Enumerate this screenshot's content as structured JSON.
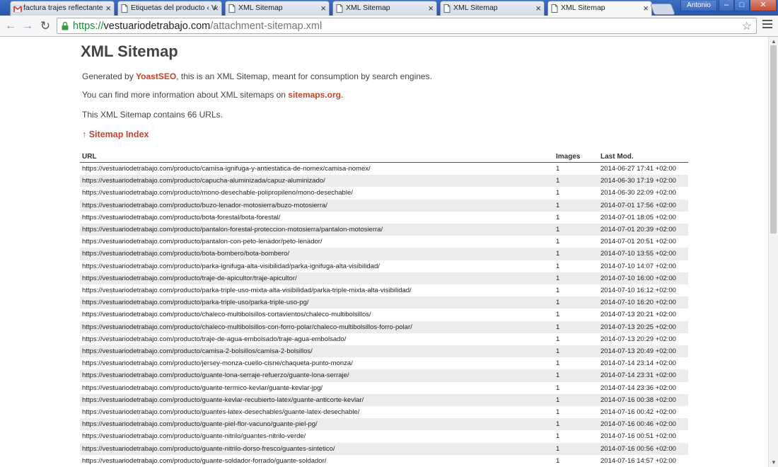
{
  "browser": {
    "tabs": [
      {
        "title": "factura trajes reflectante",
        "icon": "gmail-icon",
        "active": false
      },
      {
        "title": "Etiquetas del producto ‹ V",
        "icon": "page-icon",
        "active": false
      },
      {
        "title": "XML Sitemap",
        "icon": "page-icon",
        "active": false
      },
      {
        "title": "XML Sitemap",
        "icon": "page-icon",
        "active": false
      },
      {
        "title": "XML Sitemap",
        "icon": "page-icon",
        "active": false
      },
      {
        "title": "XML Sitemap",
        "icon": "page-icon",
        "active": true
      }
    ],
    "user_name": "Antonio",
    "url_scheme": "https://",
    "url_host": "vestuariodetrabajo.com",
    "url_path": "/attachment-sitemap.xml"
  },
  "page": {
    "title": "XML Sitemap",
    "generated_prefix": "Generated by ",
    "generator_link": "YoastSEO",
    "generated_suffix": ", this is an XML Sitemap, meant for consumption by search engines.",
    "info_prefix": "You can find more information about XML sitemaps on ",
    "info_link": "sitemaps.org",
    "info_suffix": ".",
    "count_text": "This XML Sitemap contains 66 URLs.",
    "index_link": "↑ Sitemap Index",
    "columns": [
      "URL",
      "Images",
      "Last Mod."
    ],
    "rows": [
      {
        "url": "https://vestuariodetrabajo.com/producto/camisa-ignifuga-y-antiestatica-de-nomex/camisa-nomex/",
        "images": "1",
        "lastmod": "2014-06-27 17:41 +02:00"
      },
      {
        "url": "https://vestuariodetrabajo.com/producto/capucha-aluminizada/capuz-aluminizado/",
        "images": "1",
        "lastmod": "2014-06-30 17:19 +02:00"
      },
      {
        "url": "https://vestuariodetrabajo.com/producto/mono-desechable-polipropileno/mono-desechable/",
        "images": "1",
        "lastmod": "2014-06-30 22:09 +02:00"
      },
      {
        "url": "https://vestuariodetrabajo.com/producto/buzo-lenador-motosierra/buzo-motosierra/",
        "images": "1",
        "lastmod": "2014-07-01 17:56 +02:00"
      },
      {
        "url": "https://vestuariodetrabajo.com/producto/bota-forestal/bota-forestal/",
        "images": "1",
        "lastmod": "2014-07-01 18:05 +02:00"
      },
      {
        "url": "https://vestuariodetrabajo.com/producto/pantalon-forestal-proteccion-motosierra/pantalon-motosierra/",
        "images": "1",
        "lastmod": "2014-07-01 20:39 +02:00"
      },
      {
        "url": "https://vestuariodetrabajo.com/producto/pantalon-con-peto-lenador/peto-lenador/",
        "images": "1",
        "lastmod": "2014-07-01 20:51 +02:00"
      },
      {
        "url": "https://vestuariodetrabajo.com/producto/bota-bombero/bota-bombero/",
        "images": "1",
        "lastmod": "2014-07-10 13:55 +02:00"
      },
      {
        "url": "https://vestuariodetrabajo.com/producto/parka-ignifuga-alta-visibilidad/parka-ignifuga-alta-visibilidad/",
        "images": "1",
        "lastmod": "2014-07-10 14:07 +02:00"
      },
      {
        "url": "https://vestuariodetrabajo.com/producto/traje-de-apicultor/traje-apicultor/",
        "images": "1",
        "lastmod": "2014-07-10 16:00 +02:00"
      },
      {
        "url": "https://vestuariodetrabajo.com/producto/parka-triple-uso-mixta-alta-visibilidad/parka-triple-mixta-alta-visibilidad/",
        "images": "1",
        "lastmod": "2014-07-10 16:12 +02:00"
      },
      {
        "url": "https://vestuariodetrabajo.com/producto/parka-triple-uso/parka-triple-uso-pg/",
        "images": "1",
        "lastmod": "2014-07-10 16:20 +02:00"
      },
      {
        "url": "https://vestuariodetrabajo.com/producto/chaleco-multibolsillos-cortavientos/chaleco-multibolsillos/",
        "images": "1",
        "lastmod": "2014-07-13 20:21 +02:00"
      },
      {
        "url": "https://vestuariodetrabajo.com/producto/chaleco-multibolsillos-con-forro-polar/chaleco-multibolsillos-forro-polar/",
        "images": "1",
        "lastmod": "2014-07-13 20:25 +02:00"
      },
      {
        "url": "https://vestuariodetrabajo.com/producto/traje-de-agua-embolsado/traje-agua-embolsado/",
        "images": "1",
        "lastmod": "2014-07-13 20:29 +02:00"
      },
      {
        "url": "https://vestuariodetrabajo.com/producto/camisa-2-bolsillos/camisa-2-bolsillos/",
        "images": "1",
        "lastmod": "2014-07-13 20:49 +02:00"
      },
      {
        "url": "https://vestuariodetrabajo.com/producto/jersey-monza-cuello-cisne/chaqueta-punto-monza/",
        "images": "1",
        "lastmod": "2014-07-14 23:14 +02:00"
      },
      {
        "url": "https://vestuariodetrabajo.com/producto/guante-lona-serraje-refuerzo/guante-lona-serraje/",
        "images": "1",
        "lastmod": "2014-07-14 23:31 +02:00"
      },
      {
        "url": "https://vestuariodetrabajo.com/producto/guante-termico-kevlar/guante-kevlar-jpg/",
        "images": "1",
        "lastmod": "2014-07-14 23:36 +02:00"
      },
      {
        "url": "https://vestuariodetrabajo.com/producto/guante-kevlar-recubierto-latex/guante-anticorte-kevlar/",
        "images": "1",
        "lastmod": "2014-07-16 00:38 +02:00"
      },
      {
        "url": "https://vestuariodetrabajo.com/producto/guantes-latex-desechables/guante-latex-desechable/",
        "images": "1",
        "lastmod": "2014-07-16 00:42 +02:00"
      },
      {
        "url": "https://vestuariodetrabajo.com/producto/guante-piel-flor-vacuno/guante-piel-pg/",
        "images": "1",
        "lastmod": "2014-07-16 00:46 +02:00"
      },
      {
        "url": "https://vestuariodetrabajo.com/producto/guante-nitrilo/guantes-nitrilo-verde/",
        "images": "1",
        "lastmod": "2014-07-16 00:51 +02:00"
      },
      {
        "url": "https://vestuariodetrabajo.com/producto/guante-nitrilo-dorso-fresco/guantes-sintetico/",
        "images": "1",
        "lastmod": "2014-07-16 00:56 +02:00"
      },
      {
        "url": "https://vestuariodetrabajo.com/producto/guante-soldador-forrado/guante-soldador/",
        "images": "1",
        "lastmod": "2014-07-16 14:57 +02:00"
      }
    ]
  },
  "colors": {
    "link": "#c7432a",
    "url_scheme": "#1b8c33",
    "titlebar": "#2d5fb4"
  }
}
